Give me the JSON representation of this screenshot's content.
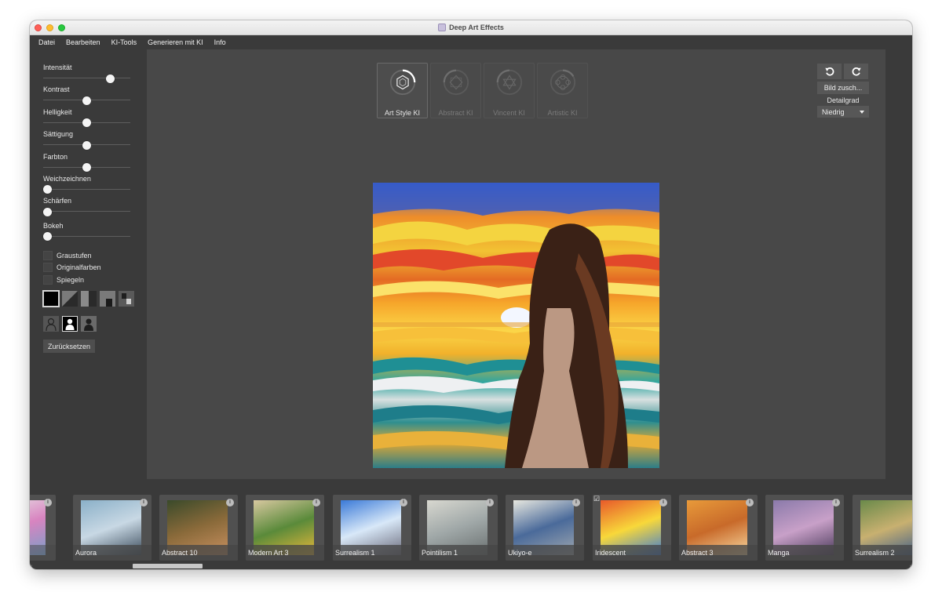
{
  "window": {
    "title": "Deep Art Effects"
  },
  "menu": [
    "Datei",
    "Bearbeiten",
    "KI-Tools",
    "Generieren mit KI",
    "Info"
  ],
  "sliders": [
    {
      "label": "Intensität",
      "value": 0.8
    },
    {
      "label": "Kontrast",
      "value": 0.5
    },
    {
      "label": "Helligkeit",
      "value": 0.5
    },
    {
      "label": "Sättigung",
      "value": 0.5
    },
    {
      "label": "Farbton",
      "value": 0.5
    },
    {
      "label": "Weichzeichnen",
      "value": 0.0
    },
    {
      "label": "Schärfen",
      "value": 0.0
    },
    {
      "label": "Bokeh",
      "value": 0.0
    }
  ],
  "checkboxes": [
    {
      "label": "Graustufen",
      "checked": false
    },
    {
      "label": "Originalfarben",
      "checked": false
    },
    {
      "label": "Spiegeln",
      "checked": false
    }
  ],
  "reset_label": "Zurücksetzen",
  "models": [
    {
      "label": "Art Style KI",
      "active": true
    },
    {
      "label": "Abstract KI",
      "active": false
    },
    {
      "label": "Vincent KI",
      "active": false
    },
    {
      "label": "Artistic KI",
      "active": false
    }
  ],
  "controls": {
    "crop_label": "Bild zusch...",
    "detail_label": "Detailgrad",
    "detail_value": "Niedrig"
  },
  "styles": [
    {
      "label": "",
      "selected": false,
      "colors": [
        "#e8e8e8",
        "#d884c0",
        "#7a9ec8"
      ]
    },
    {
      "label": "Aurora",
      "selected": false,
      "colors": [
        "#8ab0c8",
        "#c8d8e4",
        "#3a4a5a"
      ]
    },
    {
      "label": "Abstract 10",
      "selected": false,
      "colors": [
        "#3a4a2a",
        "#8a6a3a",
        "#c89060"
      ]
    },
    {
      "label": "Modern Art 3",
      "selected": false,
      "colors": [
        "#d8c8a0",
        "#5a8a3a",
        "#e8b83a"
      ]
    },
    {
      "label": "Surrealism 1",
      "selected": false,
      "colors": [
        "#3a7ad8",
        "#d8e8f8",
        "#6a6a7a"
      ]
    },
    {
      "label": "Pointilism 1",
      "selected": false,
      "colors": [
        "#d8d8d0",
        "#a0a8a8",
        "#6a7070"
      ]
    },
    {
      "label": "Ukiyo-e",
      "selected": false,
      "colors": [
        "#e8e8e0",
        "#4a6a9a",
        "#a0a8b0"
      ]
    },
    {
      "label": "Iridescent",
      "selected": true,
      "colors": [
        "#e85a2a",
        "#f8d83a",
        "#3a7ad8"
      ]
    },
    {
      "label": "Abstract 3",
      "selected": false,
      "colors": [
        "#e89a3a",
        "#c86a2a",
        "#f8d8a0"
      ]
    },
    {
      "label": "Manga",
      "selected": false,
      "colors": [
        "#8a7aaa",
        "#c8a0c8",
        "#4a3a5a"
      ]
    },
    {
      "label": "Surrealism 2",
      "selected": false,
      "colors": [
        "#6a8a4a",
        "#c8b070",
        "#3a5a8a"
      ]
    }
  ],
  "colors": {
    "window_bg": "#3a3a3a",
    "canvas_bg": "#484848",
    "panel_button": "#575757"
  }
}
